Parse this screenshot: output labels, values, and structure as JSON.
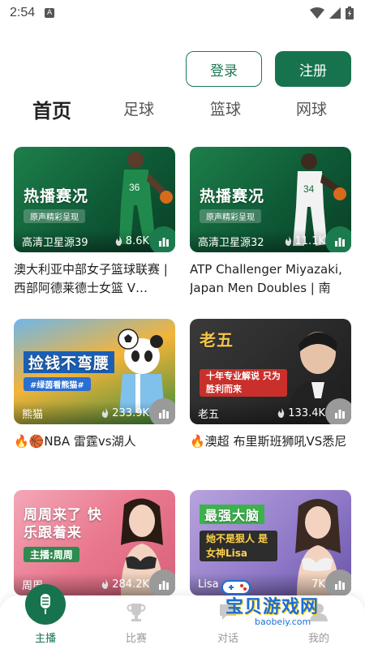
{
  "status_bar": {
    "time": "2:54",
    "notification_badge": "A"
  },
  "auth": {
    "login_label": "登录",
    "register_label": "注册"
  },
  "tabs": [
    {
      "label": "首页",
      "active": true
    },
    {
      "label": "足球",
      "active": false
    },
    {
      "label": "篮球",
      "active": false
    },
    {
      "label": "网球",
      "active": false
    }
  ],
  "cards": [
    {
      "overlay_title": "热播赛况",
      "overlay_subtitle": "原声精彩呈现",
      "source": "高清卫星源39",
      "views": "8.6K",
      "caption": "澳大利亚中部女子篮球联赛 | 西部阿德莱德士女篮 V…"
    },
    {
      "overlay_title": "热播赛况",
      "overlay_subtitle": "原声精彩呈现",
      "source": "高清卫星源32",
      "views": "11.1K",
      "caption": "ATP Challenger Miyazaki, Japan Men Doubles | 南智…"
    },
    {
      "overlay_title": "捡钱不弯腰",
      "overlay_subtitle": "#绿茵看熊猫#",
      "source": "熊猫",
      "views": "233.9K",
      "caption": "🔥🏀NBA 雷霆vs湖人"
    },
    {
      "overlay_title": "老五",
      "overlay_subtitle": "十年专业解说 只为胜利而来",
      "source": "老五",
      "views": "133.4K",
      "caption": "🔥澳超 布里斯班狮吼VS悉尼"
    },
    {
      "overlay_title": "周周来了 快乐跟着来",
      "overlay_subtitle": "主播:周周",
      "source": "周周",
      "views": "284.2K",
      "caption": ""
    },
    {
      "overlay_title": "最强大脑",
      "overlay_subtitle": "她不是狠人 是女神Lisa",
      "source": "Lisa",
      "views": "7K",
      "caption": ""
    }
  ],
  "bottom_nav": [
    {
      "label": "主播",
      "active": true,
      "icon": "microphone-icon"
    },
    {
      "label": "比赛",
      "active": false,
      "icon": "trophy-icon"
    },
    {
      "label": "对话",
      "active": false,
      "icon": "chat-icon"
    },
    {
      "label": "我的",
      "active": false,
      "icon": "user-icon"
    }
  ],
  "watermark": {
    "text": "宝贝游戏网",
    "url": "baobeiy.com"
  },
  "colors": {
    "brand_green": "#17734d",
    "text_dark": "#222222",
    "text_muted": "#999999"
  }
}
